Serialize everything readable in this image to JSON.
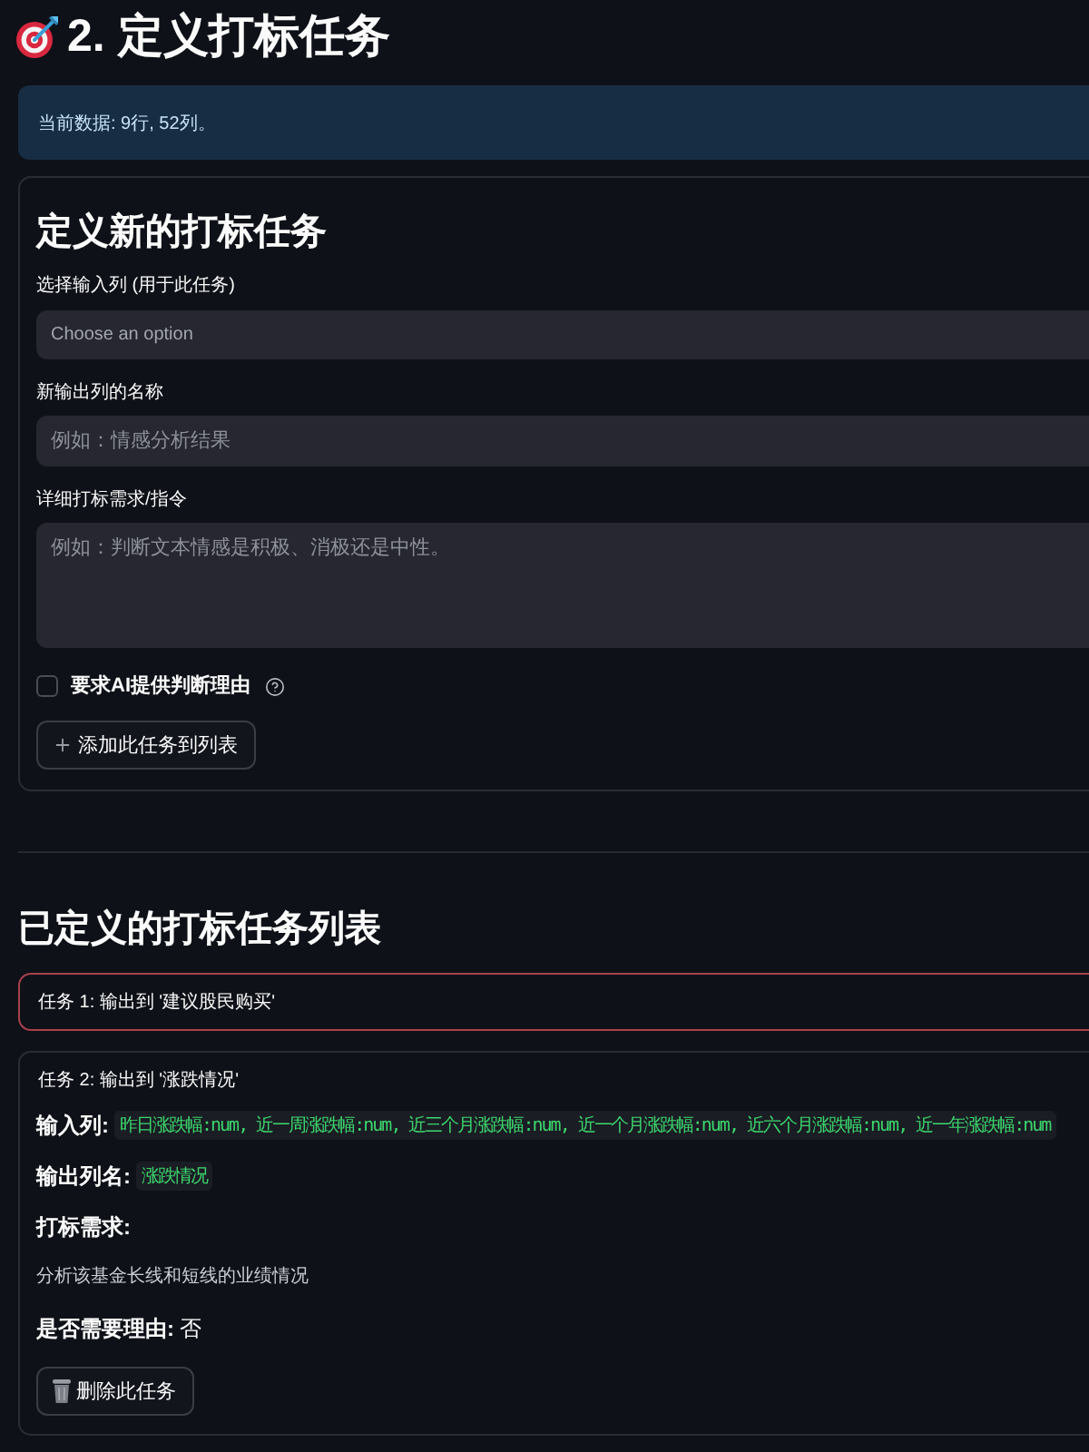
{
  "header": {
    "title": "2. 定义打标任务"
  },
  "info": {
    "text": "当前数据: 9行, 52列。"
  },
  "new_task_form": {
    "title": "定义新的打标任务",
    "fields": [
      {
        "kind": "select",
        "label": "选择输入列 (用于此任务)",
        "placeholder": "Choose an option"
      },
      {
        "kind": "input",
        "label": "新输出列的名称",
        "placeholder": "例如：情感分析结果"
      },
      {
        "kind": "textarea",
        "label": "详细打标需求/指令",
        "placeholder": "例如：判断文本情感是积极、消极还是中性。"
      }
    ],
    "reason_checkbox": {
      "label": "要求AI提供判断理由",
      "checked": false
    },
    "add_button": {
      "label": "添加此任务到列表"
    }
  },
  "task_list": {
    "title": "已定义的打标任务列表",
    "tasks": [
      {
        "title": "任务 1: 输出到 '建议股民购买'",
        "expanded": false,
        "focused": true
      },
      {
        "title": "任务 2: 输出到 '涨跌情况'",
        "expanded": true,
        "focused": false,
        "details": [
          {
            "kind": "code",
            "label": "输入列:",
            "value": "昨日涨跌幅:num, 近一周涨跌幅:num, 近三个月涨跌幅:num, 近一个月涨跌幅:num, 近六个月涨跌幅:num, 近一年涨跌幅:num"
          },
          {
            "kind": "code",
            "label": "输出列名:",
            "value": "涨跌情况"
          },
          {
            "kind": "paragraph",
            "label": "打标需求:",
            "value": "分析该基金长线和短线的业绩情况"
          },
          {
            "kind": "text",
            "label": "是否需要理由:",
            "value": "否"
          }
        ],
        "delete_button": {
          "label": "删除此任务"
        }
      }
    ]
  }
}
